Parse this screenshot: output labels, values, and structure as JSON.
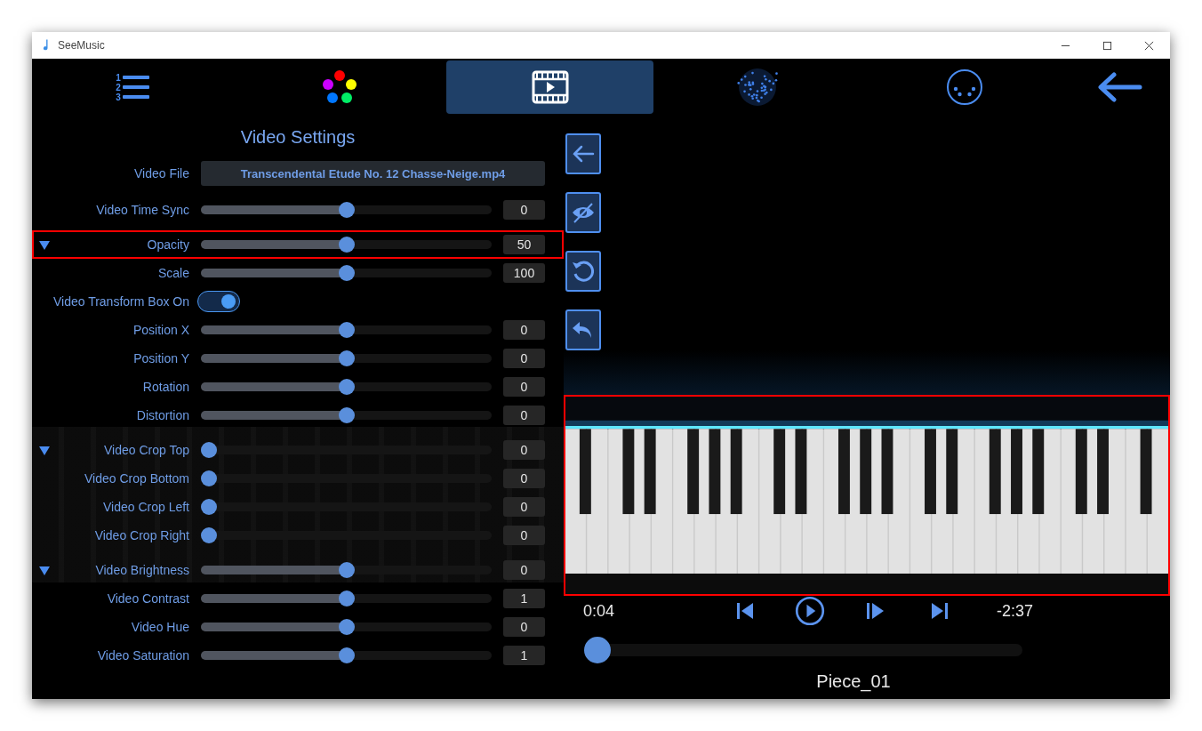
{
  "window": {
    "title": "SeeMusic"
  },
  "toolbar": {
    "tabs": [
      {
        "kind": "list",
        "selected": false,
        "digits": [
          "1",
          "2",
          "3"
        ]
      },
      {
        "kind": "colors",
        "selected": false
      },
      {
        "kind": "video",
        "selected": true
      },
      {
        "kind": "particles",
        "selected": false
      },
      {
        "kind": "dots",
        "selected": false
      },
      {
        "kind": "back",
        "selected": false
      }
    ]
  },
  "settings": {
    "title": "Video Settings",
    "video_file": {
      "label": "Video File",
      "value": "Transcendental Etude No. 12 Chasse-Neige.mp4"
    },
    "rows": [
      {
        "kind": "slider",
        "label": "Video Time Sync",
        "level": 0.5,
        "value": "0",
        "section_start": false,
        "highlighted": false
      },
      {
        "kind": "slider",
        "label": "Opacity",
        "level": 0.5,
        "value": "50",
        "section_start": true,
        "highlighted": true
      },
      {
        "kind": "slider",
        "label": "Scale",
        "level": 0.5,
        "value": "100",
        "section_start": false,
        "highlighted": false
      },
      {
        "kind": "toggle",
        "label": "Video Transform Box On",
        "on": true,
        "section_start": false,
        "highlighted": false
      },
      {
        "kind": "slider",
        "label": "Position X",
        "level": 0.5,
        "value": "0",
        "section_start": false,
        "highlighted": false
      },
      {
        "kind": "slider",
        "label": "Position Y",
        "level": 0.5,
        "value": "0",
        "section_start": false,
        "highlighted": false
      },
      {
        "kind": "slider",
        "label": "Rotation",
        "level": 0.5,
        "value": "0",
        "section_start": false,
        "highlighted": false
      },
      {
        "kind": "slider",
        "label": "Distortion",
        "level": 0.5,
        "value": "0",
        "section_start": false,
        "highlighted": false
      },
      {
        "kind": "slider",
        "label": "Video Crop Top",
        "level": 0,
        "value": "0",
        "section_start": true,
        "highlighted": false
      },
      {
        "kind": "slider",
        "label": "Video Crop Bottom",
        "level": 0,
        "value": "0",
        "section_start": false,
        "highlighted": false
      },
      {
        "kind": "slider",
        "label": "Video Crop Left",
        "level": 0,
        "value": "0",
        "section_start": false,
        "highlighted": false
      },
      {
        "kind": "slider",
        "label": "Video Crop Right",
        "level": 0,
        "value": "0",
        "section_start": false,
        "highlighted": false
      },
      {
        "kind": "slider",
        "label": "Video Brightness",
        "level": 0.5,
        "value": "0",
        "section_start": true,
        "highlighted": false
      },
      {
        "kind": "slider",
        "label": "Video Contrast",
        "level": 0.5,
        "value": "1",
        "section_start": false,
        "highlighted": false
      },
      {
        "kind": "slider",
        "label": "Video Hue",
        "level": 0.5,
        "value": "0",
        "section_start": false,
        "highlighted": false
      },
      {
        "kind": "slider",
        "label": "Video Saturation",
        "level": 0.5,
        "value": "1",
        "section_start": false,
        "highlighted": false
      }
    ]
  },
  "player": {
    "highlighted": true,
    "elapsed": "0:04",
    "remaining": "-2:37",
    "level": 0.03,
    "title": "Piece_01"
  }
}
